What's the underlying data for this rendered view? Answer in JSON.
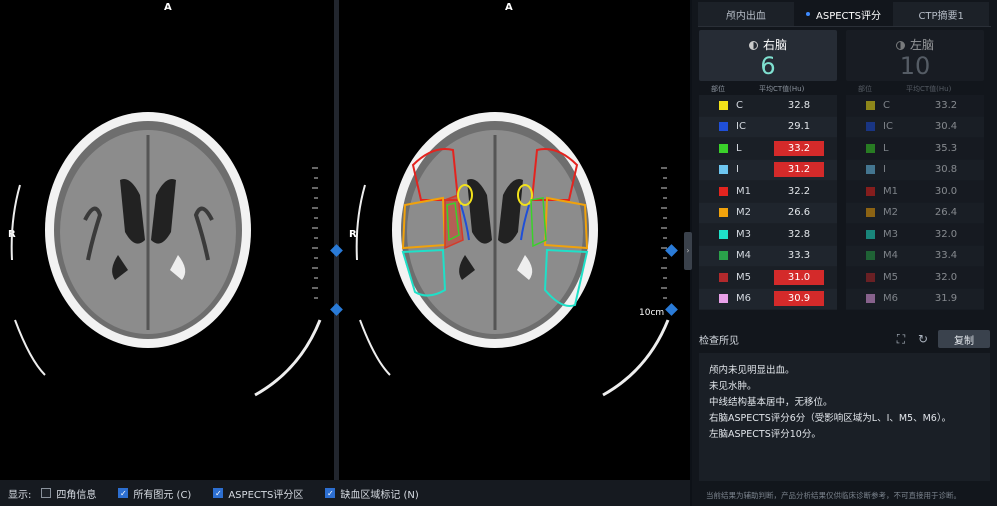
{
  "viewer": {
    "left": {
      "top_label": "A",
      "side_label": "R",
      "scale_label": ""
    },
    "right": {
      "top_label": "A",
      "side_label": "R",
      "scale_label": "10cm"
    }
  },
  "bottombar": {
    "display_label": "显示:",
    "options": [
      {
        "label": "四角信息",
        "checked": false
      },
      {
        "label": "所有图元 (C)",
        "checked": true
      },
      {
        "label": "ASPECTS评分区",
        "checked": true
      },
      {
        "label": "缺血区域标记 (N)",
        "checked": true
      }
    ]
  },
  "tabs": [
    {
      "label": "颅内出血",
      "active": false
    },
    {
      "label": "ASPECTS评分",
      "active": true
    },
    {
      "label": "CTP摘要1",
      "active": false
    }
  ],
  "hemispheres": {
    "right": {
      "title": "右脑",
      "score": "6",
      "col_region": "部位",
      "col_value": "平均CT值(Hu)",
      "rows": [
        {
          "name": "C",
          "value": "32.8",
          "color": "#f2e21a",
          "flag": false
        },
        {
          "name": "IC",
          "value": "29.1",
          "color": "#1f4fd8",
          "flag": false
        },
        {
          "name": "L",
          "value": "33.2",
          "color": "#3ad12a",
          "flag": true
        },
        {
          "name": "I",
          "value": "31.2",
          "color": "#6ec6f0",
          "flag": true
        },
        {
          "name": "M1",
          "value": "32.2",
          "color": "#e3241f",
          "flag": false
        },
        {
          "name": "M2",
          "value": "26.6",
          "color": "#f0a20c",
          "flag": false
        },
        {
          "name": "M3",
          "value": "32.8",
          "color": "#1fe0c8",
          "flag": false
        },
        {
          "name": "M4",
          "value": "33.3",
          "color": "#2aa14a",
          "flag": false
        },
        {
          "name": "M5",
          "value": "31.0",
          "color": "#b2292c",
          "flag": true
        },
        {
          "name": "M6",
          "value": "30.9",
          "color": "#e8a0e8",
          "flag": true
        }
      ]
    },
    "left": {
      "title": "左脑",
      "score": "10",
      "col_region": "部位",
      "col_value": "平均CT值(Hu)",
      "rows": [
        {
          "name": "C",
          "value": "33.2",
          "color": "#f2e21a"
        },
        {
          "name": "IC",
          "value": "30.4",
          "color": "#1f4fd8"
        },
        {
          "name": "L",
          "value": "35.3",
          "color": "#3ad12a"
        },
        {
          "name": "I",
          "value": "30.8",
          "color": "#6ec6f0"
        },
        {
          "name": "M1",
          "value": "30.0",
          "color": "#e3241f"
        },
        {
          "name": "M2",
          "value": "26.4",
          "color": "#f0a20c"
        },
        {
          "name": "M3",
          "value": "32.0",
          "color": "#1fe0c8"
        },
        {
          "name": "M4",
          "value": "33.4",
          "color": "#2aa14a"
        },
        {
          "name": "M5",
          "value": "32.0",
          "color": "#b2292c"
        },
        {
          "name": "M6",
          "value": "31.9",
          "color": "#e8a0e8"
        }
      ]
    }
  },
  "report": {
    "title": "检查所见",
    "copy_label": "复制",
    "lines": [
      "颅内未见明显出血。",
      "未见水肿。",
      "中线结构基本居中，无移位。",
      "右脑ASPECTS评分6分（受影响区域为L、I、M5、M6）。",
      "左脑ASPECTS评分10分。"
    ],
    "disclaimer": "当前结果为辅助判断，产品分析结果仅供临床诊断参考，不可直接用于诊断。"
  }
}
